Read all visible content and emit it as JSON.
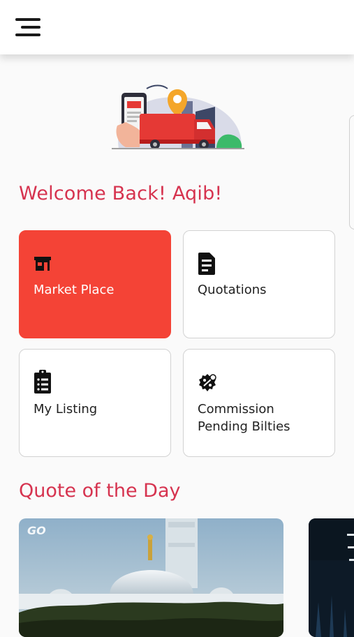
{
  "header": {
    "menu_icon": "hamburger-menu-icon"
  },
  "welcome": {
    "text": "Welcome Back! Aqib!"
  },
  "tiles": [
    {
      "label": "Market Place",
      "icon": "store-icon",
      "active": true
    },
    {
      "label": "Quotations",
      "icon": "document-icon",
      "active": false
    },
    {
      "label": "My Listing",
      "icon": "clipboard-list-icon",
      "active": false
    },
    {
      "label": "Commission\nPending Bilties",
      "icon": "discount-badge-icon",
      "active": false
    }
  ],
  "quote": {
    "title": "Quote of the Day",
    "logo_text": "GO"
  },
  "colors": {
    "accent": "#d6334f",
    "active_tile": "#f44336",
    "card_border": "#d2d2d2"
  }
}
